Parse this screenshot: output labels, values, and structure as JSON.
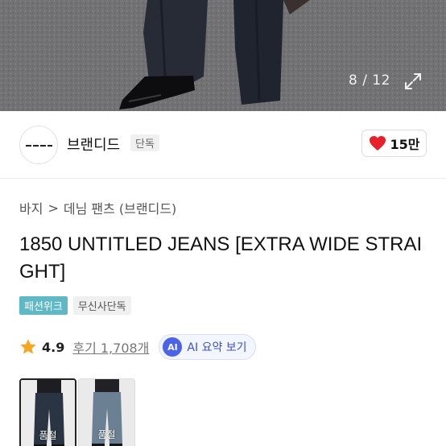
{
  "hero": {
    "counter": "8 / 12",
    "expand_icon": "expand-icon"
  },
  "brand": {
    "name": "브랜디드",
    "tag": "단독",
    "likes": "15만",
    "heart_color": "#e8202a"
  },
  "breadcrumb": {
    "category": "바지",
    "separator": ">",
    "subcategory": "데님 팬츠 (브랜디드)"
  },
  "product": {
    "title": "1850 UNTITLED JEANS [EXTRA WIDE STRAIGHT]"
  },
  "badges": [
    {
      "label": "패션위크",
      "color": "#5fb8c6"
    },
    {
      "label": "무신사단독",
      "color": "#f0f0f0"
    }
  ],
  "rating": {
    "score": "4.9",
    "reviews": "후기 1,708개",
    "star_color": "#f5a623"
  },
  "ai_summary": {
    "chip": "AI",
    "label": "AI 요약 보기",
    "accent": "#4b63e6"
  },
  "thumbnails": [
    {
      "label": "품절"
    },
    {
      "label": "품절"
    }
  ]
}
